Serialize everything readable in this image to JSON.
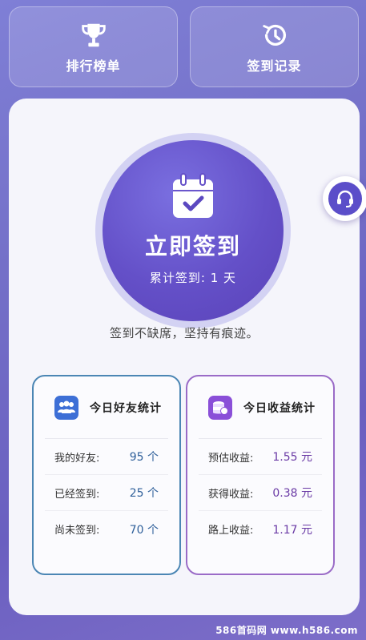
{
  "top_buttons": {
    "leaderboard_label": "排行榜单",
    "history_label": "签到记录"
  },
  "checkin": {
    "title": "立即签到",
    "count_text": "累计签到: 1 天"
  },
  "motto": "签到不缺席，坚持有痕迹。",
  "friends_stats": {
    "title": "今日好友统计",
    "rows": [
      {
        "label": "我的好友:",
        "value": "95 个"
      },
      {
        "label": "已经签到:",
        "value": "25 个"
      },
      {
        "label": "尚未签到:",
        "value": "70 个"
      }
    ]
  },
  "income_stats": {
    "title": "今日收益统计",
    "rows": [
      {
        "label": "预估收益:",
        "value": "1.55 元"
      },
      {
        "label": "获得收益:",
        "value": "0.38 元"
      },
      {
        "label": "路上收益:",
        "value": "1.17 元"
      }
    ]
  },
  "watermark": "586首码网 www.h586.com",
  "colors": {
    "primary": "#6450c8",
    "friends_border": "#4b86b4",
    "income_border": "#9a6bc7"
  },
  "icons": {
    "leaderboard": "trophy-icon",
    "history": "history-icon",
    "checkin": "calendar-check-icon",
    "friends": "users-icon",
    "income": "coins-icon",
    "support": "headset-icon"
  }
}
